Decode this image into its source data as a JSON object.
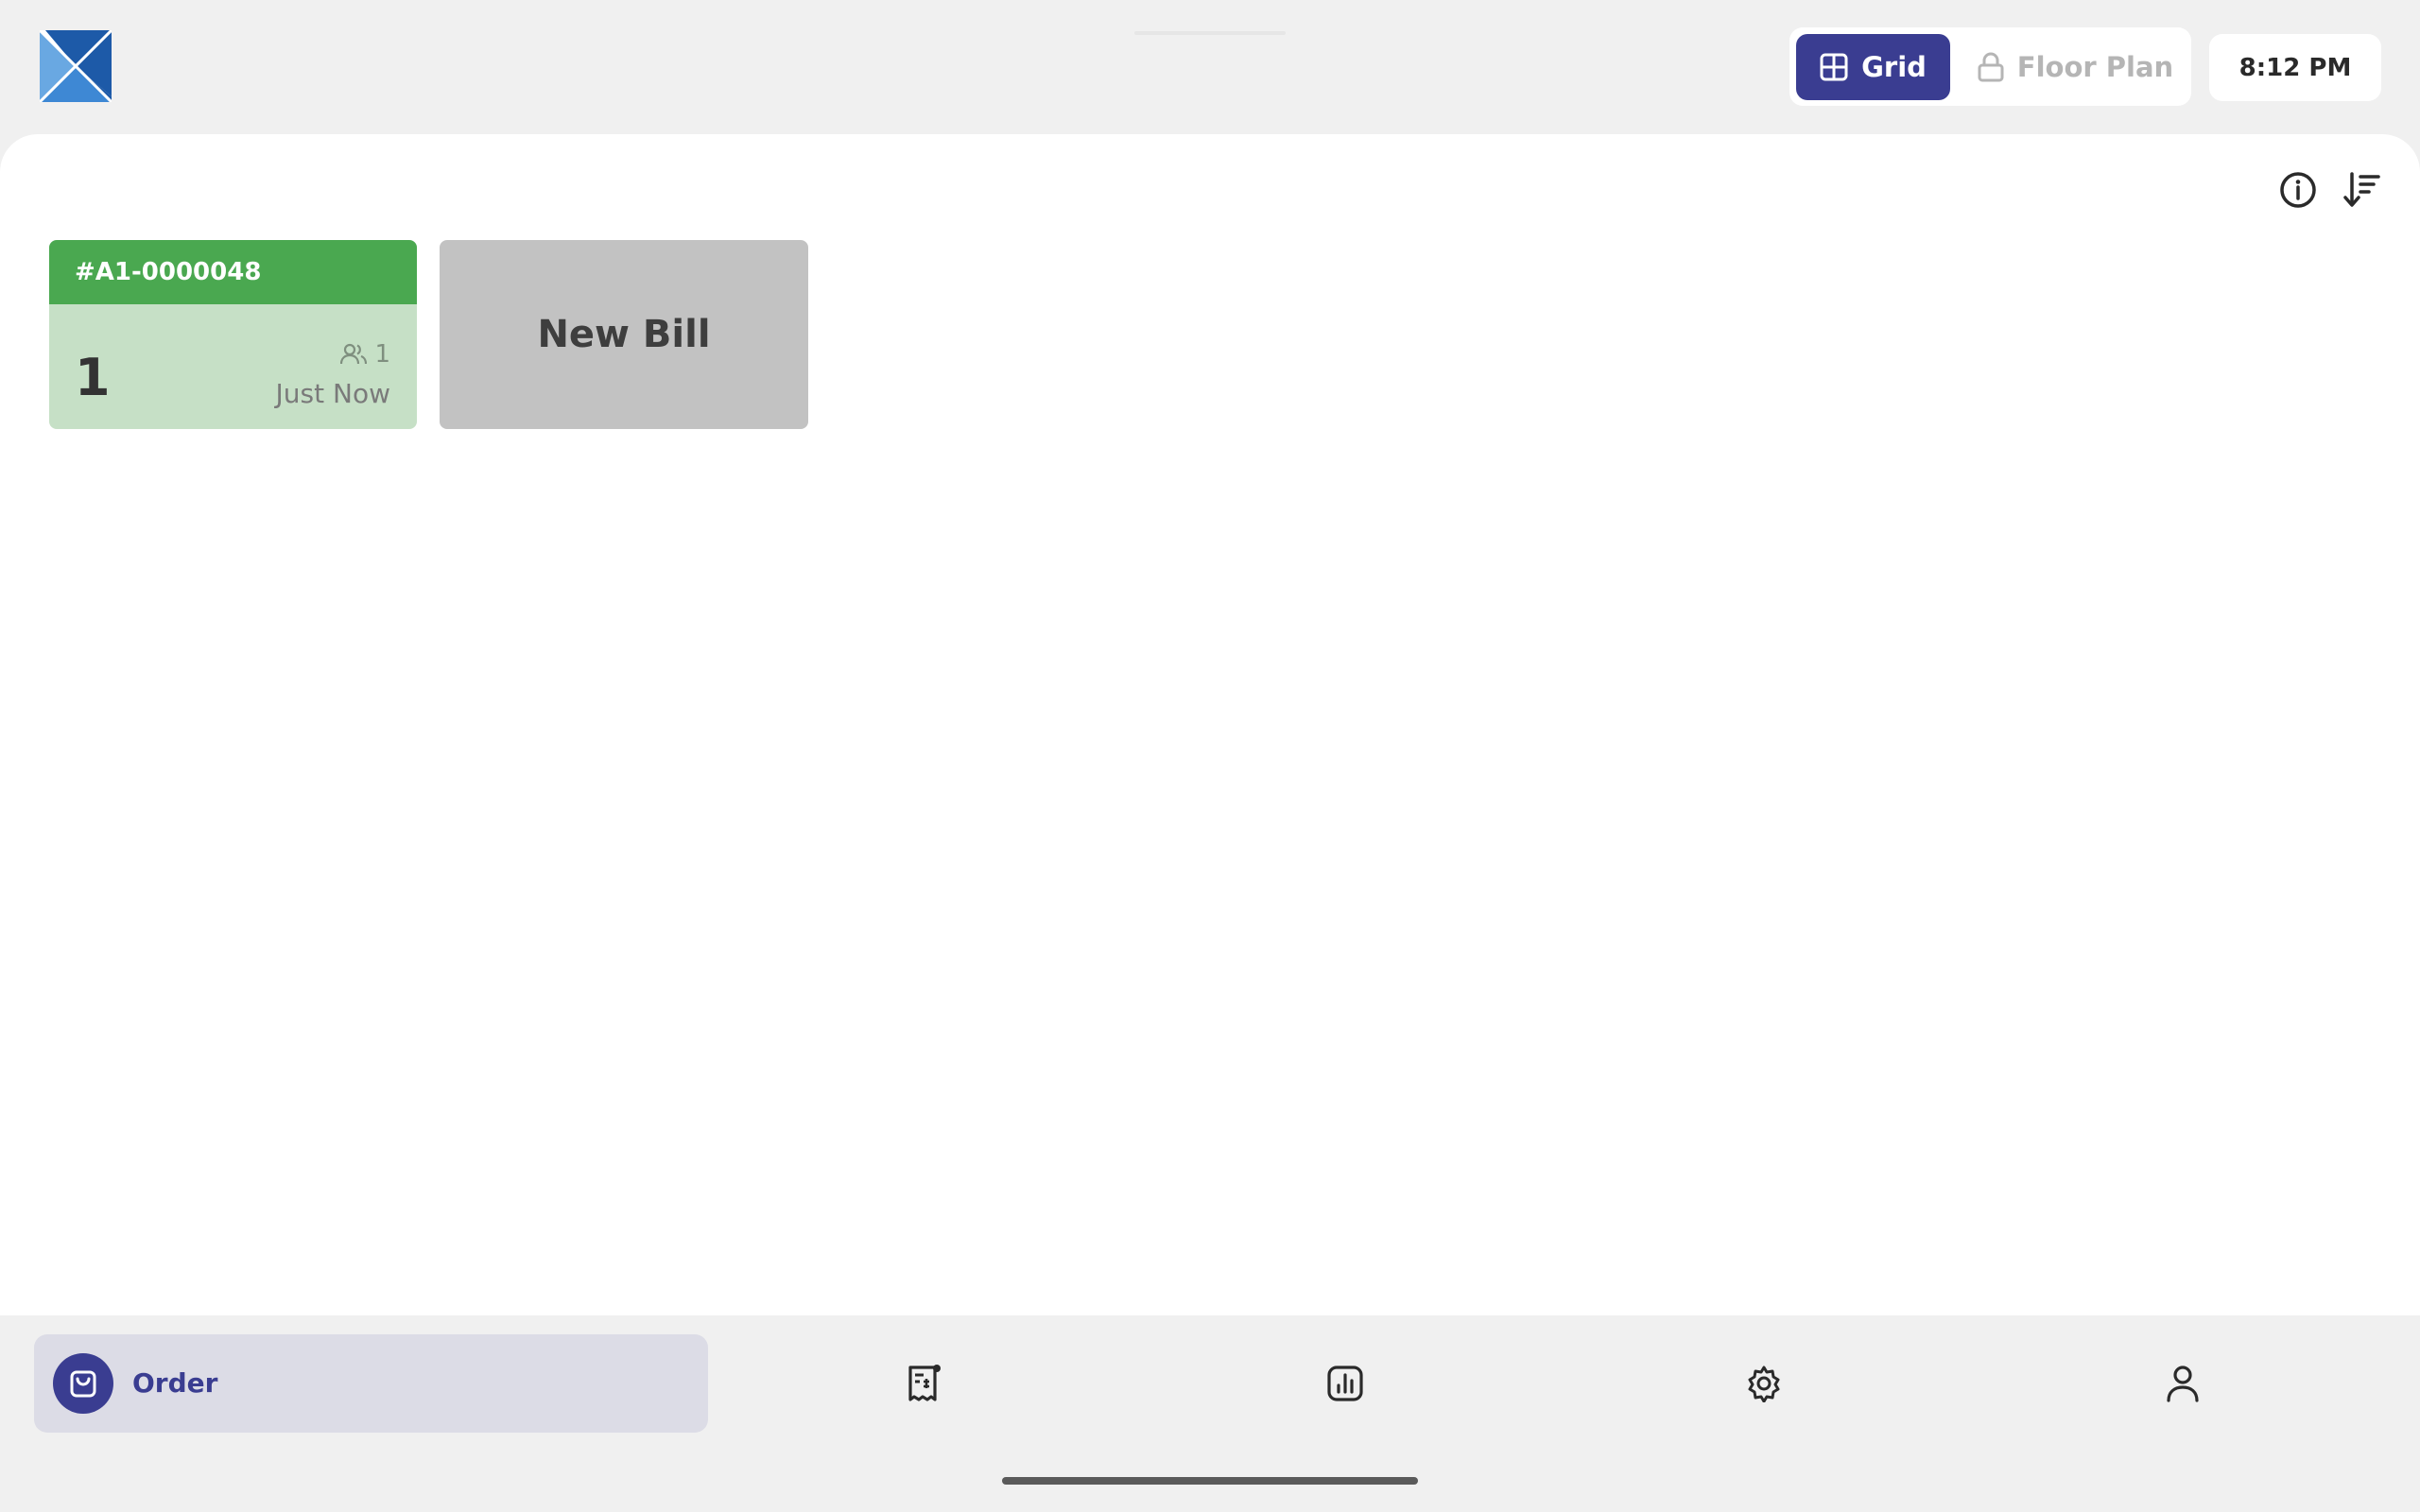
{
  "header": {
    "view_toggle": {
      "grid_label": "Grid",
      "floor_plan_label": "Floor Plan"
    },
    "clock": "8:12 PM"
  },
  "bills": [
    {
      "id": "#A1-0000048",
      "number": "1",
      "guests": "1",
      "time": "Just Now",
      "color": "#4aa850"
    }
  ],
  "new_bill_label": "New Bill",
  "bottom_nav": {
    "active_label": "Order",
    "items": [
      "bag-icon",
      "receipt-icon",
      "chart-icon",
      "gear-icon",
      "user-icon"
    ]
  },
  "colors": {
    "accent": "#3a3d91",
    "bill_header": "#4aa850",
    "bill_body": "#c6e0c6"
  }
}
